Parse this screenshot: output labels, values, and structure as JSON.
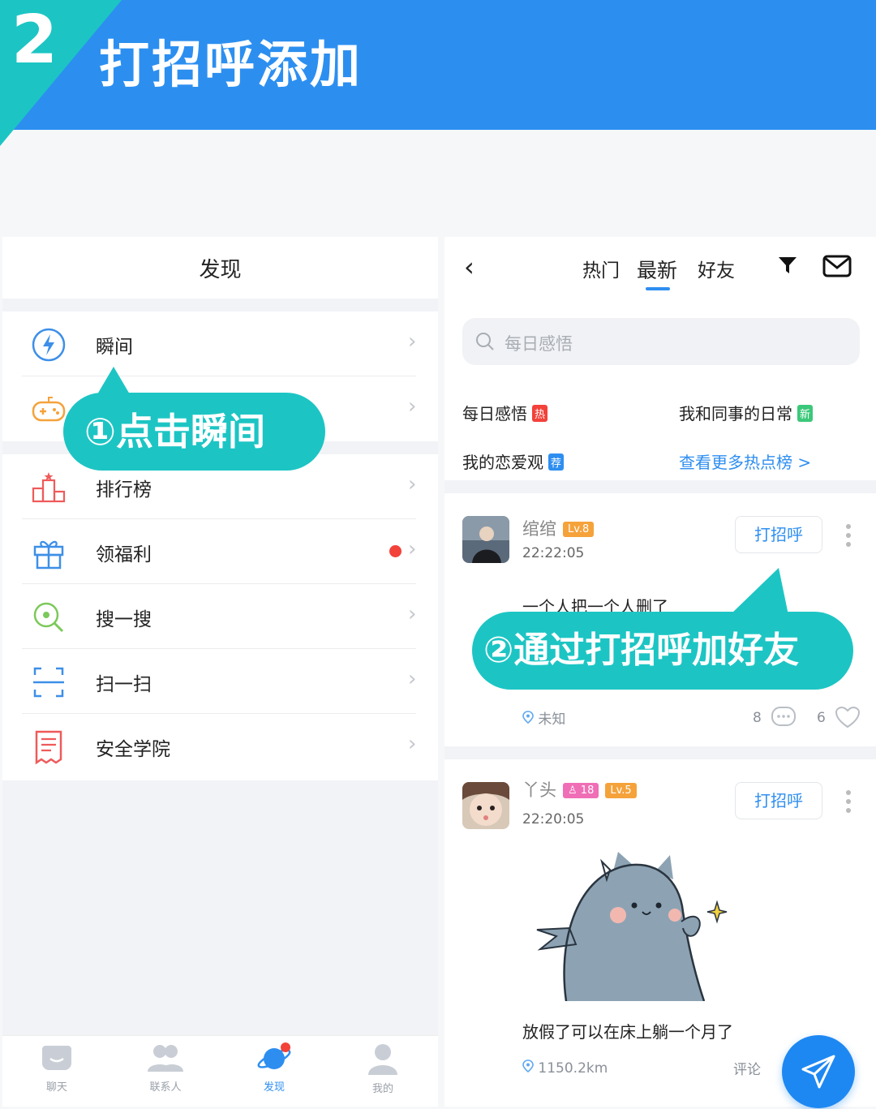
{
  "banner": {
    "step_number": "2",
    "title": "打招呼添加"
  },
  "left": {
    "header_title": "发现",
    "menu": [
      {
        "label": "瞬间",
        "icon": "lightning-icon"
      },
      {
        "label": "",
        "icon": "gamepad-icon"
      },
      {
        "label": "排行榜",
        "icon": "podium-icon"
      },
      {
        "label": "领福利",
        "icon": "gift-icon",
        "has_red_dot": true
      },
      {
        "label": "搜一搜",
        "icon": "search-circle-icon"
      },
      {
        "label": "扫一扫",
        "icon": "scan-icon"
      },
      {
        "label": "安全学院",
        "icon": "shield-doc-icon"
      }
    ],
    "tabbar": [
      {
        "label": "聊天",
        "icon": "chat-icon"
      },
      {
        "label": "联系人",
        "icon": "contacts-icon"
      },
      {
        "label": "发现",
        "icon": "planet-icon",
        "active": true
      },
      {
        "label": "我的",
        "icon": "user-icon"
      }
    ]
  },
  "callouts": {
    "step1": "①点击瞬间",
    "step2": "②通过打招呼加好友"
  },
  "right": {
    "tabs": [
      "热门",
      "最新",
      "好友"
    ],
    "active_tab": "最新",
    "search_placeholder": "每日感悟",
    "hot_topics": [
      {
        "label": "每日感悟",
        "badge": "热",
        "badge_color": "#f2423a"
      },
      {
        "label": "我和同事的日常",
        "badge": "新",
        "badge_color": "#3cc87a"
      },
      {
        "label": "我的恋爱观",
        "badge": "荐",
        "badge_color": "#2e8ef0"
      }
    ],
    "more_link": "查看更多热点榜 >",
    "posts": [
      {
        "username": "绾绾",
        "level": "Lv.8",
        "time": "22:22:05",
        "text": "一个人把一个人删了",
        "greet_label": "打招呼",
        "location": "未知",
        "comments": "8",
        "likes": "6"
      },
      {
        "username": "丫头",
        "age": "18",
        "level": "Lv.5",
        "time": "22:20:05",
        "text": "放假了可以在床上躺一个月了",
        "greet_label": "打招呼",
        "location": "1150.2km",
        "comment_label": "评论"
      }
    ]
  },
  "colors": {
    "brand_blue": "#2c8ff0",
    "callout_teal": "#1cc5c4",
    "accent_blue": "#2e8ef0"
  }
}
